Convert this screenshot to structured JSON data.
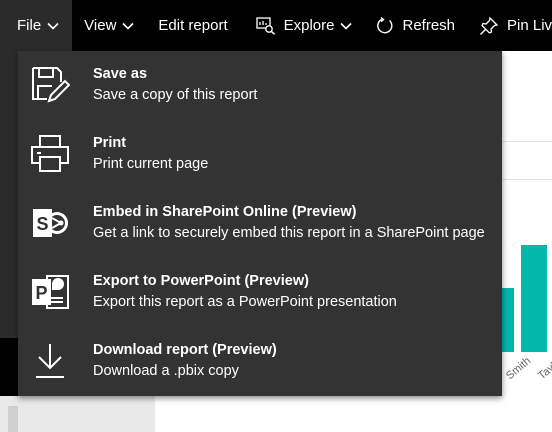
{
  "toolbar": {
    "file_label": "File",
    "view_label": "View",
    "edit_report_label": "Edit report",
    "explore_label": "Explore",
    "refresh_label": "Refresh",
    "pin_label": "Pin Liv"
  },
  "file_menu": {
    "items": [
      {
        "title": "Save as",
        "description": "Save a copy of this report",
        "icon": "save-as-icon"
      },
      {
        "title": "Print",
        "description": "Print current page",
        "icon": "printer-icon"
      },
      {
        "title": "Embed in SharePoint Online (Preview)",
        "description": "Get a link to securely embed this report in a SharePoint page",
        "icon": "sharepoint-icon"
      },
      {
        "title": "Export to PowerPoint (Preview)",
        "description": "Export this report as a PowerPoint presentation",
        "icon": "powerpoint-icon"
      },
      {
        "title": "Download report (Preview)",
        "description": "Download a .pbix copy",
        "icon": "download-icon"
      }
    ]
  },
  "report": {
    "axis_labels": [
      "Smith",
      "Tayl"
    ],
    "bar_color": "#01b8aa"
  },
  "colors": {
    "toolbar_bg": "#000000",
    "menu_bg": "#333333",
    "accent": "#01b8aa"
  }
}
